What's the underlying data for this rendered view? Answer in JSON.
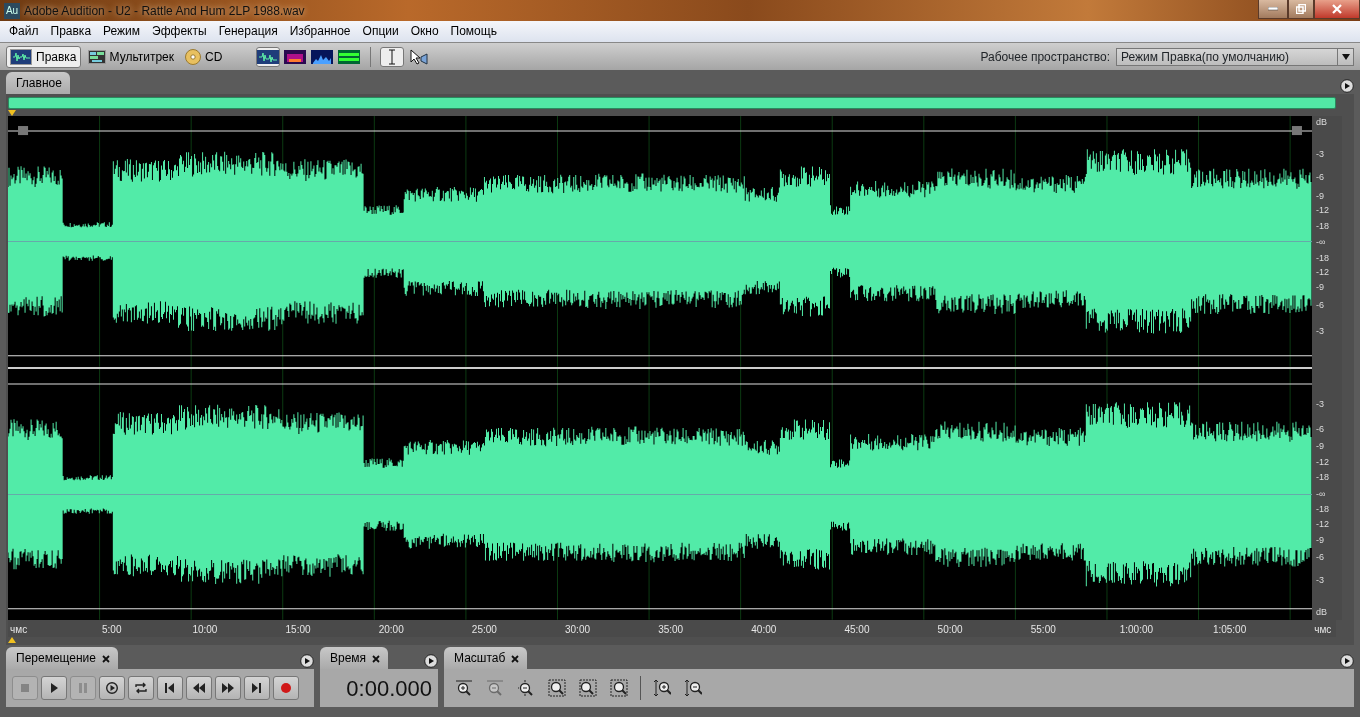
{
  "window": {
    "app_icon": "Au",
    "title": "Adobe Audition - U2 - Rattle And Hum 2LP 1988.wav"
  },
  "menu": [
    "Файл",
    "Правка",
    "Режим",
    "Эффекты",
    "Генерация",
    "Избранное",
    "Опции",
    "Окно",
    "Помощь"
  ],
  "toolbar": {
    "modes": [
      {
        "kind": "edit",
        "label": "Правка",
        "selected": true
      },
      {
        "kind": "multitrack",
        "label": "Мультитрек",
        "selected": false
      },
      {
        "kind": "cd",
        "label": "CD",
        "selected": false
      }
    ],
    "views": [
      {
        "kind": "waveform",
        "selected": true
      },
      {
        "kind": "spectral",
        "selected": false
      },
      {
        "kind": "pitch",
        "selected": false
      },
      {
        "kind": "phase",
        "selected": false
      }
    ],
    "tools": [
      {
        "kind": "ibeam",
        "selected": true
      },
      {
        "kind": "pointer",
        "selected": false
      }
    ],
    "workspace": {
      "label": "Рабочее пространство:",
      "value": "Режим Правка(по умолчанию)"
    }
  },
  "main_panel": {
    "tab": "Главное",
    "db_ruler": [
      [
        "dB",
        "-3",
        "-6",
        "-9",
        "-12",
        "-18",
        "-∞",
        "-18",
        "-12",
        "-9",
        "-6",
        "-3"
      ],
      [
        "-3",
        "-6",
        "-9",
        "-12",
        "-18",
        "-∞",
        "-18",
        "-12",
        "-9",
        "-6",
        "-3",
        "dB"
      ]
    ],
    "time_ruler": [
      "чмс",
      "5:00",
      "10:00",
      "15:00",
      "20:00",
      "25:00",
      "30:00",
      "35:00",
      "40:00",
      "45:00",
      "50:00",
      "55:00",
      "1:00:00",
      "1:05:00",
      "чмс"
    ]
  },
  "transport_panel": {
    "tab": "Перемещение",
    "buttons": [
      {
        "kind": "stop",
        "disabled": true
      },
      {
        "kind": "play",
        "disabled": false
      },
      {
        "kind": "pause",
        "disabled": true
      },
      {
        "kind": "play-from",
        "disabled": false
      },
      {
        "kind": "loop",
        "disabled": false
      },
      {
        "kind": "to-start",
        "disabled": false
      },
      {
        "kind": "rewind",
        "disabled": false
      },
      {
        "kind": "forward",
        "disabled": false
      },
      {
        "kind": "to-end",
        "disabled": false
      },
      {
        "kind": "record",
        "disabled": false
      }
    ]
  },
  "time_panel": {
    "tab": "Время",
    "value": "0:00.000"
  },
  "zoom_panel": {
    "tab": "Масштаб",
    "buttons": [
      {
        "kind": "zoom-in-h",
        "disabled": false
      },
      {
        "kind": "zoom-out-h",
        "disabled": true
      },
      {
        "kind": "zoom-full",
        "disabled": false
      },
      {
        "kind": "zoom-selection",
        "disabled": false
      },
      {
        "kind": "zoom-left",
        "disabled": false
      },
      {
        "kind": "zoom-right",
        "disabled": false
      },
      {
        "kind": "zoom-in-v",
        "disabled": false
      },
      {
        "kind": "zoom-out-v",
        "disabled": false
      }
    ]
  }
}
